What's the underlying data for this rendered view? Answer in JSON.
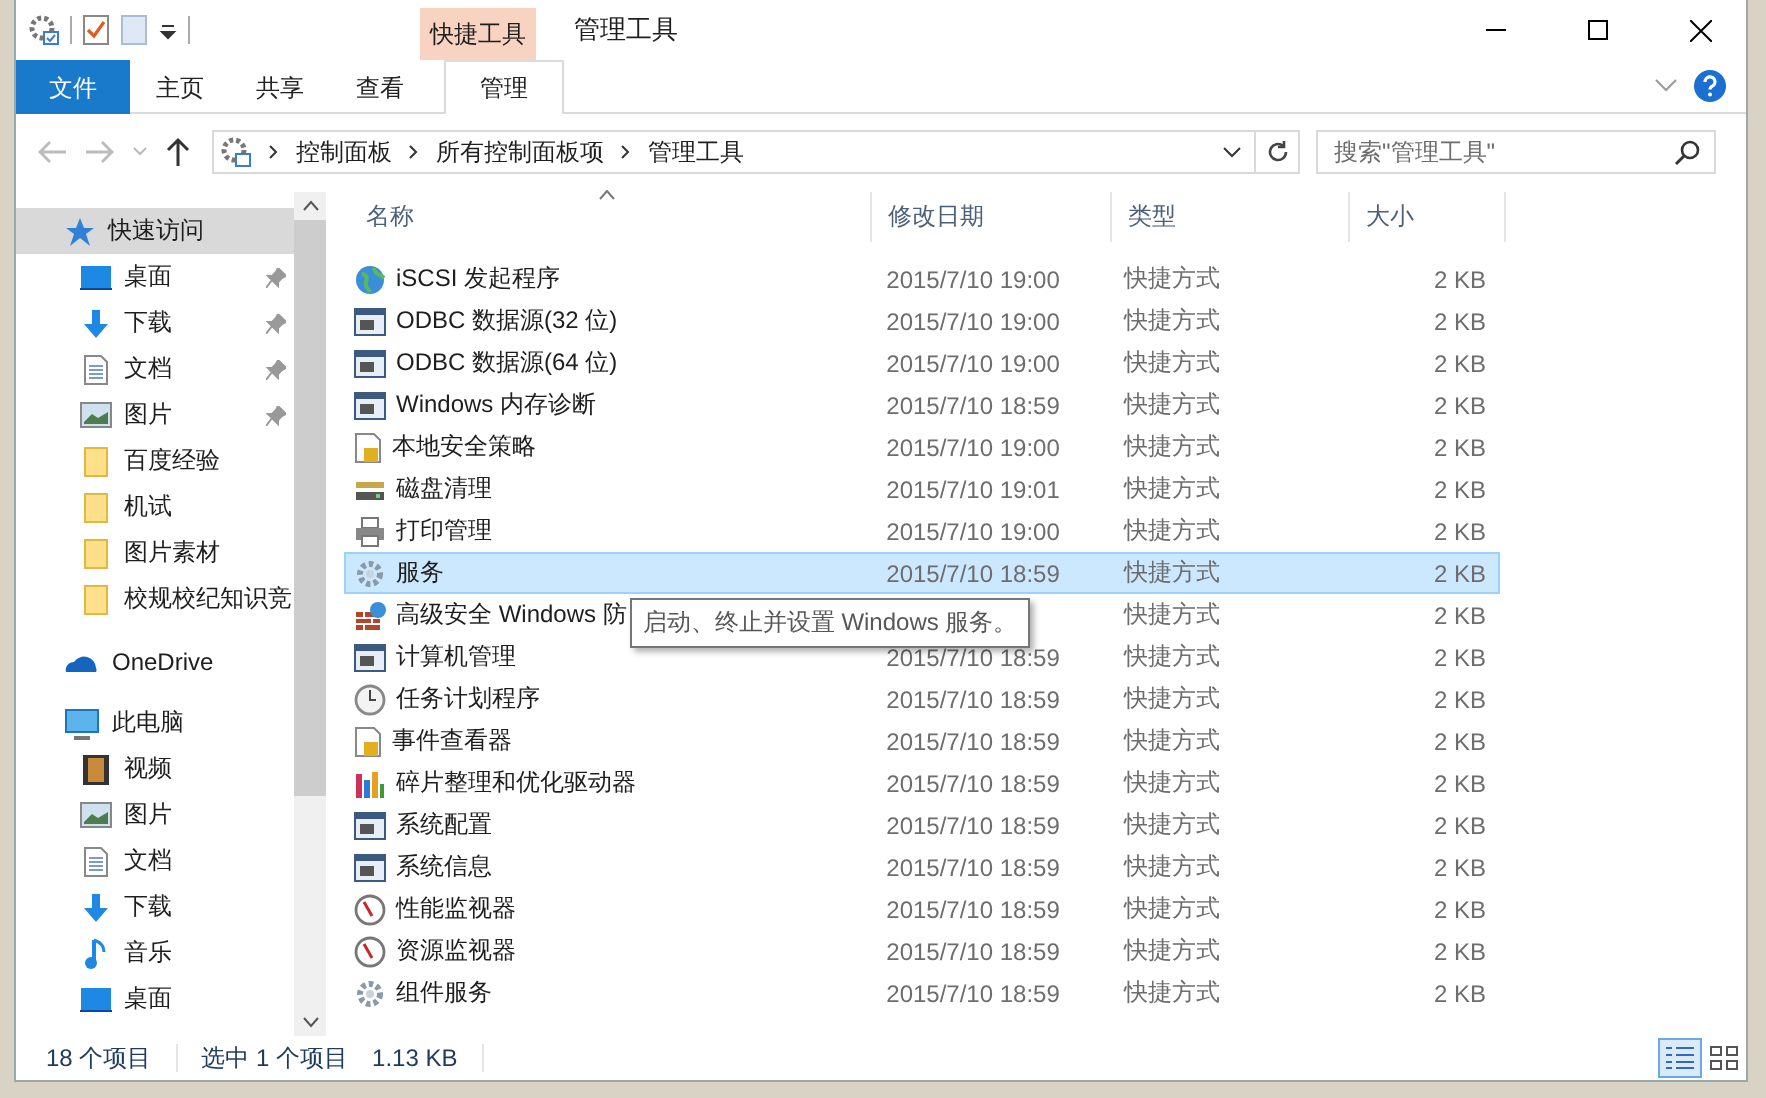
{
  "title_bar": {
    "context_group": "快捷工具",
    "title": "管理工具"
  },
  "ribbon_tabs": [
    {
      "label": "文件",
      "kind": "file",
      "selected": false
    },
    {
      "label": "主页",
      "kind": "tab",
      "selected": false
    },
    {
      "label": "共享",
      "kind": "tab",
      "selected": false
    },
    {
      "label": "查看",
      "kind": "tab",
      "selected": false
    },
    {
      "label": "管理",
      "kind": "context",
      "selected": true
    }
  ],
  "address_bar": {
    "breadcrumbs": [
      "控制面板",
      "所有控制面板项",
      "管理工具"
    ]
  },
  "search": {
    "placeholder": "搜索\"管理工具\""
  },
  "sidebar": {
    "sections": [
      {
        "label": "快速访问",
        "kind": "star",
        "selected": true,
        "children": [
          {
            "label": "桌面",
            "kind": "desktop",
            "pinned": true,
            "selected": false
          },
          {
            "label": "下载",
            "kind": "download",
            "pinned": true,
            "selected": false
          },
          {
            "label": "文档",
            "kind": "document",
            "pinned": true,
            "selected": false
          },
          {
            "label": "图片",
            "kind": "picture",
            "pinned": true,
            "selected": false
          },
          {
            "label": "百度经验",
            "kind": "folder",
            "pinned": false,
            "selected": false
          },
          {
            "label": "机试",
            "kind": "folder",
            "pinned": false,
            "selected": false
          },
          {
            "label": "图片素材",
            "kind": "folder",
            "pinned": false,
            "selected": false
          },
          {
            "label": "校规校纪知识竞",
            "kind": "folder",
            "pinned": false,
            "selected": false
          }
        ]
      },
      {
        "label": "OneDrive",
        "kind": "cloud",
        "selected": false
      },
      {
        "label": "此电脑",
        "kind": "computer",
        "selected": false,
        "children": [
          {
            "label": "视频",
            "kind": "video",
            "pinned": false,
            "selected": false
          },
          {
            "label": "图片",
            "kind": "picture",
            "pinned": false,
            "selected": false
          },
          {
            "label": "文档",
            "kind": "document",
            "pinned": false,
            "selected": false
          },
          {
            "label": "下载",
            "kind": "download",
            "pinned": false,
            "selected": false
          },
          {
            "label": "音乐",
            "kind": "music",
            "pinned": false,
            "selected": false
          },
          {
            "label": "桌面",
            "kind": "desktop",
            "pinned": false,
            "selected": false
          }
        ]
      }
    ]
  },
  "table": {
    "columns": [
      {
        "label": "名称",
        "sorted": true
      },
      {
        "label": "修改日期",
        "sorted": false
      },
      {
        "label": "类型",
        "sorted": false
      },
      {
        "label": "大小",
        "sorted": false
      }
    ],
    "rows": [
      {
        "name": "iSCSI 发起程序",
        "modified": "2015/7/10 19:00",
        "type": "快捷方式",
        "size": "2 KB",
        "kind": "globe",
        "selected": false
      },
      {
        "name": "ODBC 数据源(32 位)",
        "modified": "2015/7/10 19:00",
        "type": "快捷方式",
        "size": "2 KB",
        "kind": "console",
        "selected": false
      },
      {
        "name": "ODBC 数据源(64 位)",
        "modified": "2015/7/10 19:00",
        "type": "快捷方式",
        "size": "2 KB",
        "kind": "console",
        "selected": false
      },
      {
        "name": "Windows 内存诊断",
        "modified": "2015/7/10 18:59",
        "type": "快捷方式",
        "size": "2 KB",
        "kind": "console",
        "selected": false
      },
      {
        "name": "本地安全策略",
        "modified": "2015/7/10 19:00",
        "type": "快捷方式",
        "size": "2 KB",
        "kind": "document",
        "selected": false
      },
      {
        "name": "磁盘清理",
        "modified": "2015/7/10 19:01",
        "type": "快捷方式",
        "size": "2 KB",
        "kind": "disk",
        "selected": false
      },
      {
        "name": "打印管理",
        "modified": "2015/7/10 19:00",
        "type": "快捷方式",
        "size": "2 KB",
        "kind": "printer",
        "selected": false
      },
      {
        "name": "服务",
        "modified": "2015/7/10 18:59",
        "type": "快捷方式",
        "size": "2 KB",
        "kind": "gear",
        "selected": true
      },
      {
        "name": "高级安全 Windows 防",
        "type": "快捷方式",
        "size": "2 KB",
        "kind": "wall",
        "selected": false,
        "tooltip": "启动、终止并设置 Windows 服务。"
      },
      {
        "name": "计算机管理",
        "modified": "2015/7/10 18:59",
        "type": "快捷方式",
        "size": "2 KB",
        "kind": "console",
        "selected": false
      },
      {
        "name": "任务计划程序",
        "modified": "2015/7/10 18:59",
        "type": "快捷方式",
        "size": "2 KB",
        "kind": "clock",
        "selected": false
      },
      {
        "name": "事件查看器",
        "modified": "2015/7/10 18:59",
        "type": "快捷方式",
        "size": "2 KB",
        "kind": "document",
        "selected": false
      },
      {
        "name": "碎片整理和优化驱动器",
        "modified": "2015/7/10 18:59",
        "type": "快捷方式",
        "size": "2 KB",
        "kind": "defrag",
        "selected": false
      },
      {
        "name": "系统配置",
        "modified": "2015/7/10 18:59",
        "type": "快捷方式",
        "size": "2 KB",
        "kind": "console",
        "selected": false
      },
      {
        "name": "系统信息",
        "modified": "2015/7/10 18:59",
        "type": "快捷方式",
        "size": "2 KB",
        "kind": "console",
        "selected": false
      },
      {
        "name": "性能监视器",
        "modified": "2015/7/10 18:59",
        "type": "快捷方式",
        "size": "2 KB",
        "kind": "gauge",
        "selected": false
      },
      {
        "name": "资源监视器",
        "modified": "2015/7/10 18:59",
        "type": "快捷方式",
        "size": "2 KB",
        "kind": "gauge",
        "selected": false
      },
      {
        "name": "组件服务",
        "modified": "2015/7/10 18:59",
        "type": "快捷方式",
        "size": "2 KB",
        "kind": "gear",
        "selected": false
      }
    ]
  },
  "status_bar": {
    "item_count": "18 个项目",
    "selection": "选中 1 个项目",
    "selection_size": "1.13 KB"
  },
  "view_buttons": [
    {
      "kind": "details",
      "selected": true
    },
    {
      "kind": "tiles",
      "selected": false
    }
  ]
}
